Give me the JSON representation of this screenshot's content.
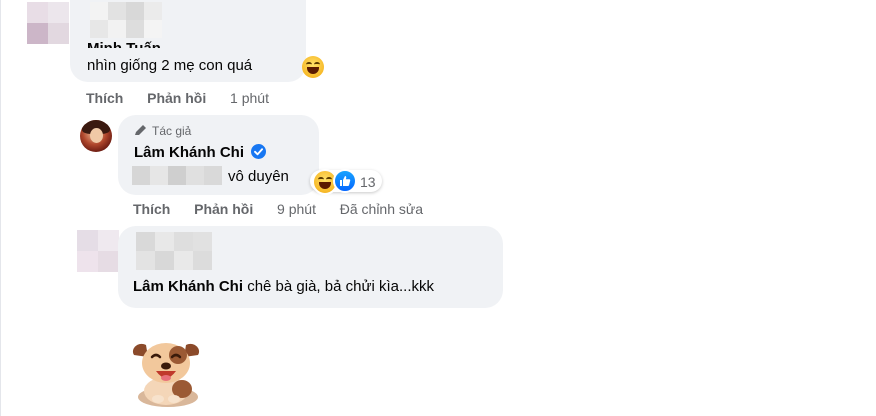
{
  "comments": [
    {
      "author": "Minh Tuấn",
      "text": "nhìn giống 2 mẹ con quá",
      "emoji": "laughing-face-icon",
      "actions": {
        "like": "Thích",
        "reply": "Phản hồi",
        "time": "1 phút"
      }
    },
    {
      "badge": "Tác giả",
      "author": "Lâm Khánh Chi",
      "verified": true,
      "text": "vô duyên",
      "reactions": {
        "icons": [
          "haha-reaction-icon",
          "like-reaction-icon"
        ],
        "count": "13"
      },
      "actions": {
        "like": "Thích",
        "reply": "Phản hồi",
        "time": "9 phút",
        "edited": "Đã chỉnh sửa"
      }
    },
    {
      "mention": "Lâm Khánh Chi",
      "text": "chê bà già, bả chửi kìa...kkk",
      "sticker": "dog-sticker"
    }
  ],
  "colors": {
    "bubble": "#f0f2f5",
    "meta": "#65676b",
    "verified": "#1877f2",
    "like": "#0866ff"
  }
}
